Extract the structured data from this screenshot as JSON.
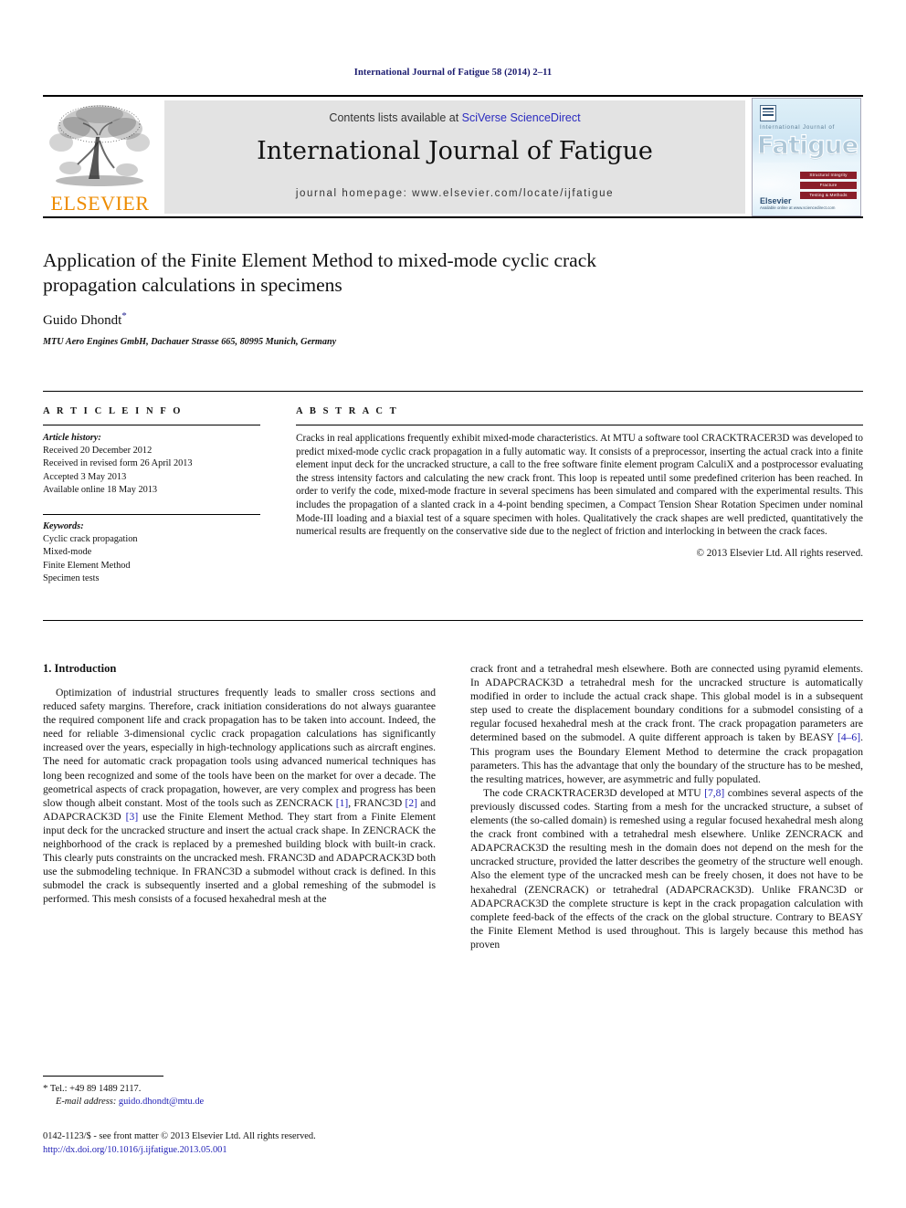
{
  "running_head": "International Journal of Fatigue 58 (2014) 2–11",
  "masthead": {
    "contents_prefix": "Contents lists available at ",
    "sciencedirect": "SciVerse ScienceDirect",
    "journal_title": "International Journal of Fatigue",
    "homepage": "journal homepage: www.elsevier.com/locate/ijfatigue",
    "publisher_logo_text": "ELSEVIER",
    "publisher_logo_color": "#ED8B00",
    "link_color": "#2b2bbf",
    "band_color": "#e3e3e3",
    "cover": {
      "superline": "International Journal of",
      "title": "Fatigue",
      "bars": [
        "Structural Integrity",
        "Fracture",
        "Testing & Methods"
      ],
      "foot_logo": "Elsevier",
      "foot_text": "Available online at www.sciencedirect.com"
    }
  },
  "article": {
    "title": "Application of the Finite Element Method to mixed-mode cyclic crack propagation calculations in specimens",
    "author": "Guido Dhondt",
    "author_mark": "*",
    "affiliation": "MTU Aero Engines GmbH, Dachauer Strasse 665, 80995 Munich, Germany"
  },
  "article_info": {
    "heading": "A R T I C L E   I N F O",
    "history_label": "Article history:",
    "history": [
      "Received 20 December 2012",
      "Received in revised form 26 April 2013",
      "Accepted 3 May 2013",
      "Available online 18 May 2013"
    ],
    "keywords_label": "Keywords:",
    "keywords": [
      "Cyclic crack propagation",
      "Mixed-mode",
      "Finite Element Method",
      "Specimen tests"
    ]
  },
  "abstract": {
    "heading": "A B S T R A C T",
    "text": "Cracks in real applications frequently exhibit mixed-mode characteristics. At MTU a software tool CRACKTRACER3D was developed to predict mixed-mode cyclic crack propagation in a fully automatic way. It consists of a preprocessor, inserting the actual crack into a finite element input deck for the uncracked structure, a call to the free software finite element program CalculiX and a postprocessor evaluating the stress intensity factors and calculating the new crack front. This loop is repeated until some predefined criterion has been reached. In order to verify the code, mixed-mode fracture in several specimens has been simulated and compared with the experimental results. This includes the propagation of a slanted crack in a 4-point bending specimen, a Compact Tension Shear Rotation Specimen under nominal Mode-III loading and a biaxial test of a square specimen with holes. Qualitatively the crack shapes are well predicted, quantitatively the numerical results are frequently on the conservative side due to the neglect of friction and interlocking in between the crack faces.",
    "copyright": "© 2013 Elsevier Ltd. All rights reserved."
  },
  "body": {
    "section_heading": "1. Introduction",
    "left_para_1": "Optimization of industrial structures frequently leads to smaller cross sections and reduced safety margins. Therefore, crack initiation considerations do not always guarantee the required component life and crack propagation has to be taken into account. Indeed, the need for reliable 3-dimensional cyclic crack propagation calculations has significantly increased over the years, especially in high-technology applications such as aircraft engines. The need for automatic crack propagation tools using advanced numerical techniques has long been recognized and some of the tools have been on the market for over a decade. The geometrical aspects of crack propagation, however, are very complex and progress has been slow though albeit constant. Most of the tools such as ZENCRACK ",
    "cite_1": "[1]",
    "left_para_1b": ", FRANC3D ",
    "cite_2": "[2]",
    "left_para_1c": " and ADAPCRACK3D ",
    "cite_3": "[3]",
    "left_para_1d": " use the Finite Element Method. They start from a Finite Element input deck for the uncracked structure and insert the actual crack shape. In ZENCRACK the neighborhood of the crack is replaced by a premeshed building block with built-in crack. This clearly puts constraints on the uncracked mesh. FRANC3D and ADAPCRACK3D both use the submodeling technique. In FRANC3D a submodel without crack is defined. In this submodel the crack is subsequently inserted and a global remeshing of the submodel is performed. This mesh consists of a focused hexahedral mesh at the",
    "right_para_1": "crack front and a tetrahedral mesh elsewhere. Both are connected using pyramid elements. In ADAPCRACK3D a tetrahedral mesh for the uncracked structure is automatically modified in order to include the actual crack shape. This global model is in a subsequent step used to create the displacement boundary conditions for a submodel consisting of a regular focused hexahedral mesh at the crack front. The crack propagation parameters are determined based on the submodel. A quite different approach is taken by BEASY ",
    "cite_4": "[4–6]",
    "right_para_1b": ". This program uses the Boundary Element Method to determine the crack propagation parameters. This has the advantage that only the boundary of the structure has to be meshed, the resulting matrices, however, are asymmetric and fully populated.",
    "right_para_2": "The code CRACKTRACER3D developed at MTU ",
    "cite_5": "[7,8]",
    "right_para_2b": " combines several aspects of the previously discussed codes. Starting from a mesh for the uncracked structure, a subset of elements (the so-called domain) is remeshed using a regular focused hexahedral mesh along the crack front combined with a tetrahedral mesh elsewhere. Unlike ZENCRACK and ADAPCRACK3D the resulting mesh in the domain does not depend on the mesh for the uncracked structure, provided the latter describes the geometry of the structure well enough. Also the element type of the uncracked mesh can be freely chosen, it does not have to be hexahedral (ZENCRACK) or tetrahedral (ADAPCRACK3D). Unlike FRANC3D or ADAPCRACK3D the complete structure is kept in the crack propagation calculation with complete feed-back of the effects of the crack on the global structure. Contrary to BEASY the Finite Element Method is used throughout. This is largely because this method has proven"
  },
  "footnote": {
    "star": "*",
    "tel": " Tel.: +49 89 1489 2117.",
    "email_label": "E-mail address:",
    "email": "guido.dhondt@mtu.de"
  },
  "footer": {
    "issn_line": "0142-1123/$ - see front matter © 2013 Elsevier Ltd. All rights reserved.",
    "doi": "http://dx.doi.org/10.1016/j.ijfatigue.2013.05.001"
  }
}
